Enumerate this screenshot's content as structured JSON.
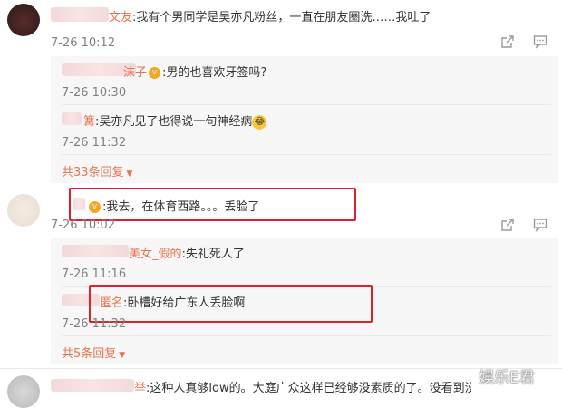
{
  "comments": [
    {
      "user_suffix": "文友",
      "text": ":我有个男同学是吴亦凡粉丝，一直在朋友圈洗……我吐了",
      "time": "7-26 10:12",
      "replies": [
        {
          "user_suffix": "沫子",
          "text": ":男的也喜欢牙签吗?",
          "time": "7-26 10:30"
        },
        {
          "user_suffix": "篝",
          "text": ":吴亦凡见了也得说一句神经病",
          "time": "7-26 11:32"
        }
      ],
      "more": "共33条回复"
    },
    {
      "user_suffix": "",
      "text": ":我去，在体育西路。。。丢脸了",
      "time": "7-26 10:02",
      "replies": [
        {
          "user_suffix": "美女_假的",
          "text": ":失礼死人了",
          "time": "7-26 11:16"
        },
        {
          "user_suffix": "匿名",
          "text": ":卧槽好给广东人丢脸啊",
          "time": "7-26 11:32"
        }
      ],
      "more": "共5条回复"
    },
    {
      "user_suffix": "举",
      "text": ":这种人真够low的。大庭广众这样已经够没素质的了。没看到没一个人吗他吗?"
    }
  ],
  "watermark": "娱乐E君",
  "icons": {
    "share": "share-icon",
    "comment": "comment-icon"
  }
}
